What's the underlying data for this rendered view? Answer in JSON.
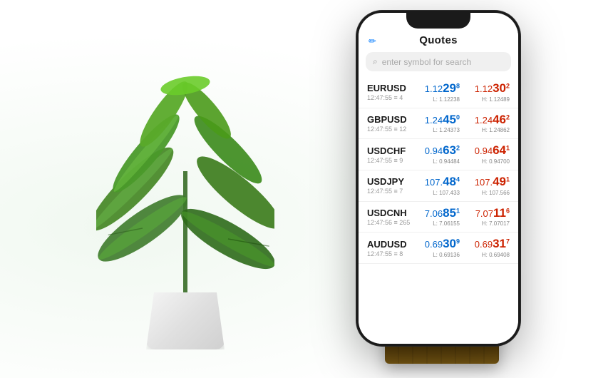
{
  "page": {
    "background": "#ffffff"
  },
  "phone": {
    "header": {
      "title": "Quotes",
      "edit_icon": "✏"
    },
    "search": {
      "placeholder": "enter symbol for search",
      "icon": "🔍"
    },
    "quotes": [
      {
        "symbol": "EURUSD",
        "time": "12:47:55",
        "bid_prefix": "1.12",
        "bid_main": "29",
        "bid_sup": "8",
        "bid_low": "L: 1.12238",
        "ask_prefix": "1.12",
        "ask_main": "30",
        "ask_sup": "2",
        "ask_high": "H: 1.12489"
      },
      {
        "symbol": "GBPUSD",
        "time": "12:47:55",
        "bid_prefix": "1.24",
        "bid_main": "45",
        "bid_sup": "0",
        "bid_low": "L: 1.24373",
        "ask_prefix": "1.24",
        "ask_main": "46",
        "ask_sup": "2",
        "ask_high": "H: 1.24862"
      },
      {
        "symbol": "USDCHF",
        "time": "12:47:55",
        "bid_prefix": "0.94",
        "bid_main": "63",
        "bid_sup": "2",
        "bid_low": "L: 0.94484",
        "ask_prefix": "0.94",
        "ask_main": "64",
        "ask_sup": "1",
        "ask_high": "H: 0.94700"
      },
      {
        "symbol": "USDJPY",
        "time": "12:47:55",
        "bid_prefix": "107.",
        "bid_main": "48",
        "bid_sup": "4",
        "bid_low": "L: 107.433",
        "ask_prefix": "107.",
        "ask_main": "49",
        "ask_sup": "1",
        "ask_high": "H: 107.566"
      },
      {
        "symbol": "USDCNH",
        "time": "12:47:56",
        "bid_prefix": "7.06",
        "bid_main": "85",
        "bid_sup": "1",
        "bid_low": "L: 7.06155",
        "ask_prefix": "7.07",
        "ask_main": "11",
        "ask_sup": "6",
        "ask_high": "H: 7.07017"
      },
      {
        "symbol": "AUDUSD",
        "time": "12:47:55",
        "bid_prefix": "0.69",
        "bid_main": "30",
        "bid_sup": "9",
        "bid_low": "L: 0.69136",
        "ask_prefix": "0.69",
        "ask_main": "31",
        "ask_sup": "7",
        "ask_high": "H: 0.69408"
      }
    ]
  }
}
